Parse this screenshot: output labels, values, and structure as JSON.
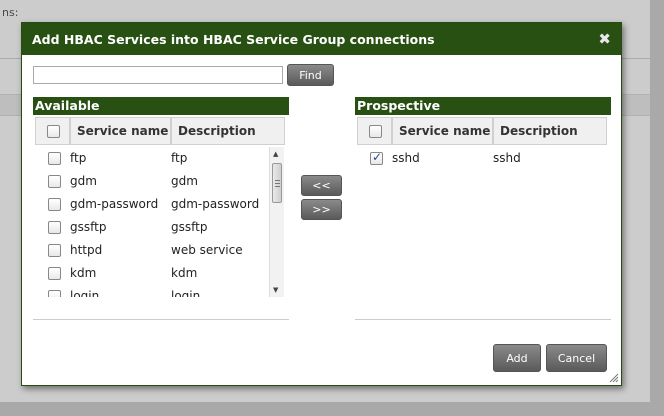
{
  "background": {
    "label_fragment": "ns:"
  },
  "dialog": {
    "title": "Add HBAC Services into HBAC Service Group connections",
    "close_symbol": "✖",
    "search": {
      "value": "",
      "placeholder": ""
    },
    "find_label": "Find",
    "available": {
      "header": "Available",
      "columns": [
        "Service name",
        "Description"
      ],
      "rows": [
        {
          "name": "ftp",
          "description": "ftp",
          "checked": false
        },
        {
          "name": "gdm",
          "description": "gdm",
          "checked": false
        },
        {
          "name": "gdm-password",
          "description": "gdm-password",
          "checked": false
        },
        {
          "name": "gssftp",
          "description": "gssftp",
          "checked": false
        },
        {
          "name": "httpd",
          "description": "web service",
          "checked": false
        },
        {
          "name": "kdm",
          "description": "kdm",
          "checked": false
        },
        {
          "name": "login",
          "description": "login",
          "checked": false
        }
      ]
    },
    "prospective": {
      "header": "Prospective",
      "columns": [
        "Service name",
        "Description"
      ],
      "rows": [
        {
          "name": "sshd",
          "description": "sshd",
          "checked": true
        }
      ]
    },
    "move_left_label": "<<",
    "move_right_label": ">>",
    "add_label": "Add",
    "cancel_label": "Cancel"
  },
  "colors": {
    "header_green": "#285013",
    "button_gray": "#6f6f6f"
  },
  "icons": {
    "close": "close-icon",
    "scroll_up": "scroll-up-arrow-icon",
    "scroll_down": "scroll-down-arrow-icon",
    "resize": "resize-grip-icon"
  }
}
